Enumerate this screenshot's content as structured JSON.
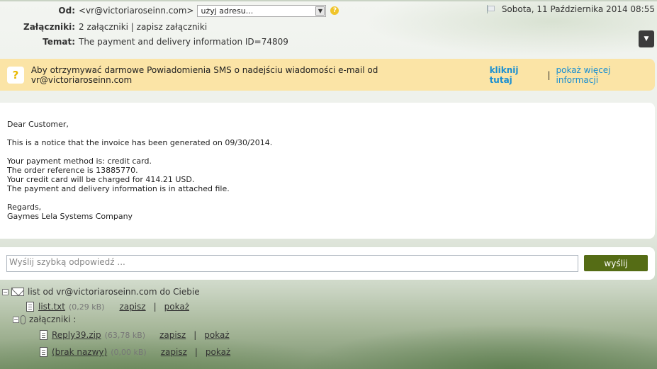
{
  "header": {
    "from_label": "Od:",
    "from_value": "<vr@victoriaroseinn.com>",
    "sender_select_value": "użyj adresu...",
    "date": "Sobota, 11 Października 2014 08:55",
    "attachments_label": "Załączniki:",
    "attachments_value": "2 załączniki | zapisz załączniki",
    "subject_label": "Temat:",
    "subject_value": "The payment and delivery information ID=74809"
  },
  "banner": {
    "icon_glyph": "?",
    "text": "Aby otrzymywać darmowe Powiadomienia SMS o nadejściu wiadomości e-mail od vr@victoriaroseinn.com",
    "link_bold": "kliknij tutaj",
    "separator": "|",
    "link_more": "pokaż więcej informacji",
    "link_color": "#1a8fd1",
    "background": "#fbe4a6"
  },
  "message": {
    "lines": [
      "Dear Customer,",
      "",
      "This is a notice that the invoice has been generated on 09/30/2014.",
      "",
      "Your payment method is: credit card.",
      "The order reference is 13885770.",
      "Your credit card will be charged for 414.21 USD.",
      "The payment and delivery information is in attached file.",
      "",
      "Regards,",
      "Gaymes Lela Systems Company"
    ]
  },
  "reply": {
    "placeholder": "Wyślij szybką odpowiedź ...",
    "send_label": "wyślij",
    "send_color": "#556c15"
  },
  "tree": {
    "root_label": "list od vr@victoriaroseinn.com do Ciebie",
    "file1": {
      "name": "list.txt",
      "size": "(0,29 kB)",
      "save": "zapisz",
      "sep": "|",
      "show": "pokaż"
    },
    "attachments_label": "załączniki :",
    "file2": {
      "name": "Reply39.zip",
      "size": "(63,78 kB)",
      "save": "zapisz",
      "sep": "|",
      "show": "pokaż"
    },
    "file3": {
      "name": "(brak nazwy)",
      "size": "(0,00 kB)",
      "save": "zapisz",
      "sep": "|",
      "show": "pokaż"
    }
  }
}
